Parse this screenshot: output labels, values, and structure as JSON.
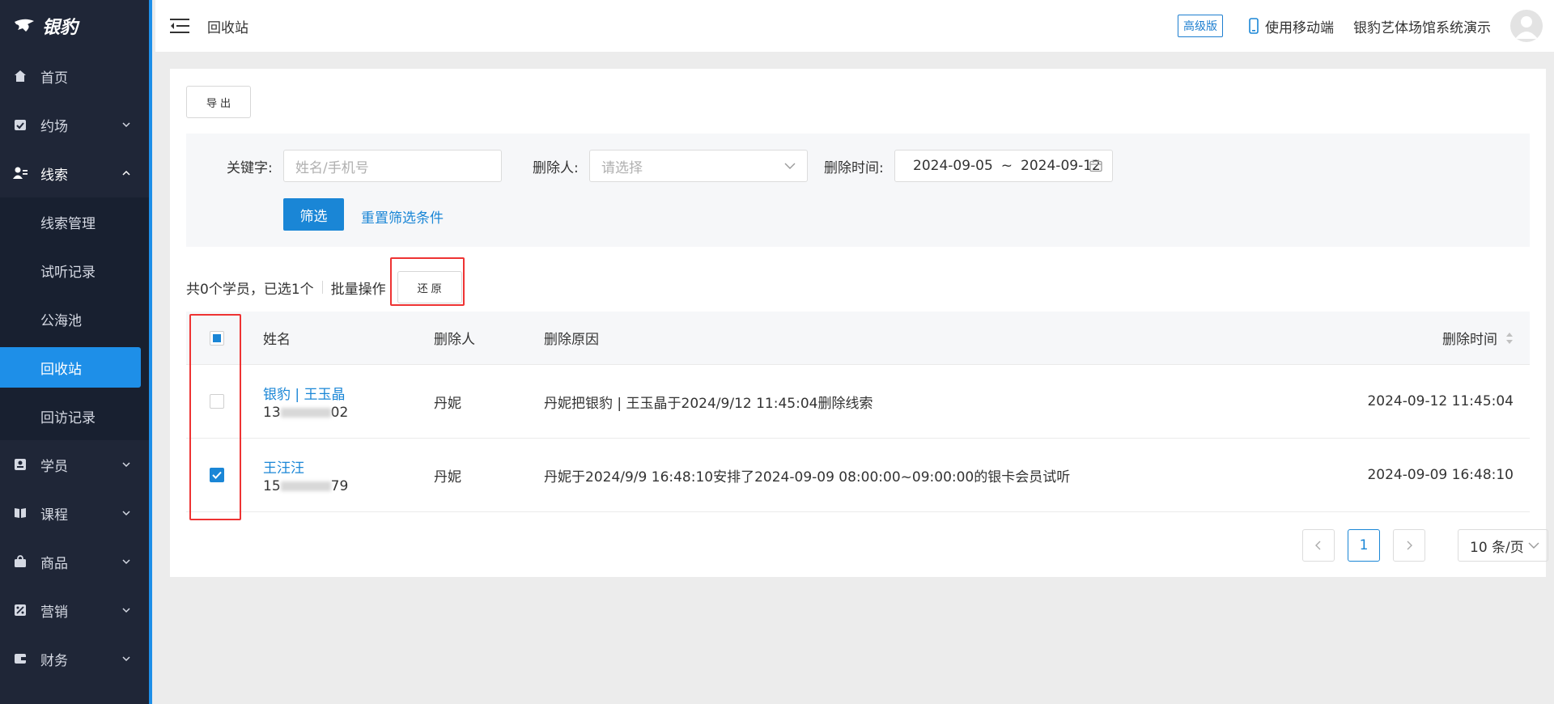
{
  "brand": {
    "name": "银豹"
  },
  "sidebar": {
    "items": [
      {
        "label": "首页",
        "icon": "home-icon",
        "expandable": false
      },
      {
        "label": "约场",
        "icon": "calendar-check-icon",
        "expandable": true
      },
      {
        "label": "线索",
        "icon": "user-clue-icon",
        "expandable": true,
        "open": true,
        "children": [
          {
            "label": "线索管理"
          },
          {
            "label": "试听记录"
          },
          {
            "label": "公海池"
          },
          {
            "label": "回收站",
            "active": true
          },
          {
            "label": "回访记录"
          }
        ]
      },
      {
        "label": "学员",
        "icon": "student-card-icon",
        "expandable": true
      },
      {
        "label": "课程",
        "icon": "book-icon",
        "expandable": true
      },
      {
        "label": "商品",
        "icon": "shopping-bag-icon",
        "expandable": true
      },
      {
        "label": "营销",
        "icon": "percent-icon",
        "expandable": true
      },
      {
        "label": "财务",
        "icon": "wallet-icon",
        "expandable": true
      }
    ]
  },
  "header": {
    "breadcrumb": "回收站",
    "badge": "高级版",
    "mobile_label": "使用移动端",
    "org_name": "银豹艺体场馆系统演示"
  },
  "toolbar": {
    "export_label": "导 出"
  },
  "filters": {
    "keyword_label": "关键字:",
    "keyword_placeholder": "姓名/手机号",
    "deleter_label": "删除人:",
    "deleter_placeholder": "请选择",
    "date_label": "删除时间:",
    "date_start": "2024-09-05",
    "date_sep": "~",
    "date_end": "2024-09-12",
    "apply_label": "筛选",
    "reset_label": "重置筛选条件"
  },
  "summary": {
    "count_text": "共0个学员，已选1个",
    "batch_label": "批量操作",
    "restore_label": "还 原"
  },
  "table": {
    "columns": [
      "姓名",
      "删除人",
      "删除原因",
      "删除时间"
    ],
    "rows": [
      {
        "checked": false,
        "name": "银豹 | 王玉晶",
        "phone_prefix": "13",
        "phone_suffix": "02",
        "deleter": "丹妮",
        "reason": "丹妮把银豹 | 王玉晶于2024/9/12 11:45:04删除线索",
        "time": "2024-09-12 11:45:04"
      },
      {
        "checked": true,
        "name": "王汪汪",
        "phone_prefix": "15",
        "phone_suffix": "79",
        "deleter": "丹妮",
        "reason": "丹妮于2024/9/9 16:48:10安排了2024-09-09 08:00:00~09:00:00的银卡会员试听",
        "time": "2024-09-09 16:48:10"
      }
    ]
  },
  "pagination": {
    "current": "1",
    "page_size": "10 条/页"
  },
  "colors": {
    "primary": "#1a86d6",
    "sidebar_bg": "#1f2637",
    "highlight": "#e33333"
  }
}
